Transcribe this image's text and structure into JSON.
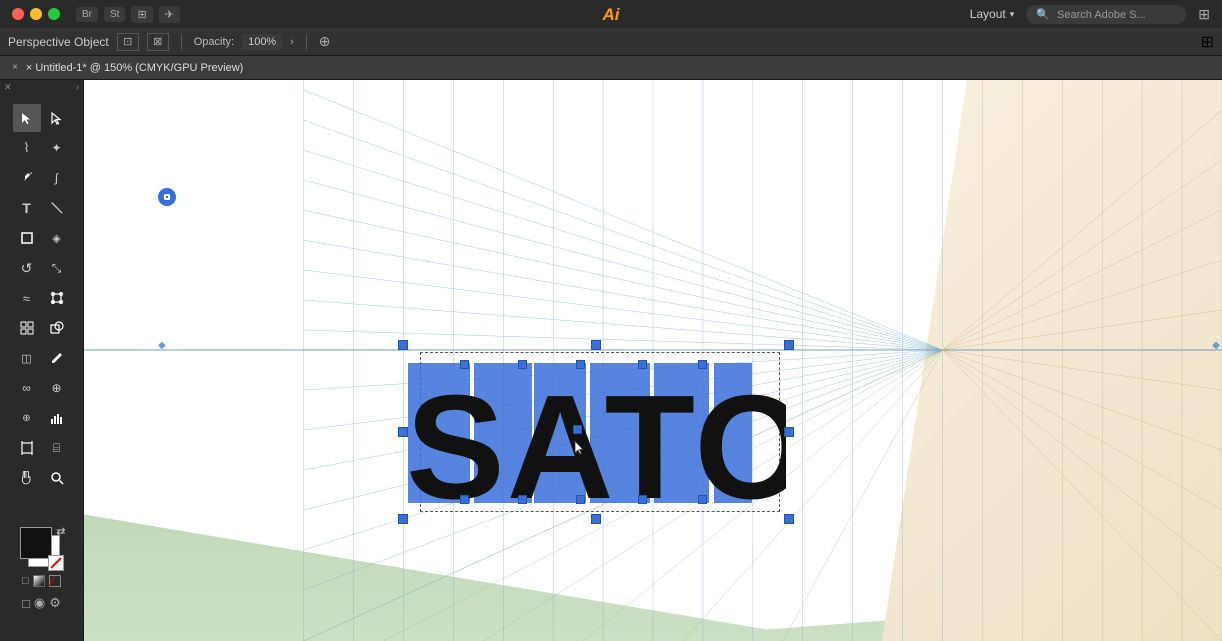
{
  "titlebar": {
    "app_logo": "Ai",
    "layout_label": "Layout",
    "search_placeholder": "Search Adobe S...",
    "ext_apps": [
      "Br",
      "St"
    ],
    "traffic_lights": [
      "close",
      "minimize",
      "maximize"
    ]
  },
  "toolbar": {
    "context_label": "Perspective Object",
    "opacity_label": "Opacity:",
    "opacity_value": "100%",
    "expand_icon": "›"
  },
  "doctab": {
    "title": "× Untitled-1* @ 150% (CMYK/GPU Preview)",
    "close": "×"
  },
  "toolbox": {
    "tools": [
      {
        "id": "select",
        "icon": "▶",
        "label": "Selection Tool"
      },
      {
        "id": "direct-select",
        "icon": "▷",
        "label": "Direct Selection Tool"
      },
      {
        "id": "lasso",
        "icon": "⌇",
        "label": "Lasso Tool"
      },
      {
        "id": "magic-wand",
        "icon": "✦",
        "label": "Magic Wand Tool"
      },
      {
        "id": "pen",
        "icon": "✒",
        "label": "Pen Tool"
      },
      {
        "id": "curvature",
        "icon": "∫",
        "label": "Curvature Tool"
      },
      {
        "id": "type",
        "icon": "T",
        "label": "Type Tool"
      },
      {
        "id": "line",
        "icon": "/",
        "label": "Line Tool"
      },
      {
        "id": "rect",
        "icon": "□",
        "label": "Rectangle Tool"
      },
      {
        "id": "eraser",
        "icon": "◈",
        "label": "Eraser Tool"
      },
      {
        "id": "rotate",
        "icon": "↺",
        "label": "Rotate Tool"
      },
      {
        "id": "scale",
        "icon": "⤡",
        "label": "Scale Tool"
      },
      {
        "id": "warp",
        "icon": "≈",
        "label": "Warp Tool"
      },
      {
        "id": "free-transform",
        "icon": "⊡",
        "label": "Free Transform Tool"
      },
      {
        "id": "perspective-grid",
        "icon": "⊞",
        "label": "Perspective Grid Tool"
      },
      {
        "id": "gradient",
        "icon": "◫",
        "label": "Gradient Tool"
      },
      {
        "id": "eyedropper",
        "icon": "✦",
        "label": "Eyedropper Tool"
      },
      {
        "id": "blend",
        "icon": "∞",
        "label": "Blend Tool"
      },
      {
        "id": "symbol",
        "icon": "⊕",
        "label": "Symbol Sprayer Tool"
      },
      {
        "id": "bar-chart",
        "icon": "▦",
        "label": "Bar Graph Tool"
      },
      {
        "id": "artboard",
        "icon": "⊓",
        "label": "Artboard Tool"
      },
      {
        "id": "slice",
        "icon": "⌸",
        "label": "Slice Tool"
      },
      {
        "id": "hand",
        "icon": "✋",
        "label": "Hand Tool"
      },
      {
        "id": "zoom",
        "icon": "⊕",
        "label": "Zoom Tool"
      }
    ],
    "fg_color": "#111111",
    "bg_color": "#ffffff"
  },
  "canvas": {
    "title": "Untitled-1",
    "zoom": "150%",
    "color_mode": "CMYK/GPU Preview",
    "satori_text": "SATORI",
    "grid_color": "#6699cc",
    "perspective_label": "Perspective Grid"
  }
}
